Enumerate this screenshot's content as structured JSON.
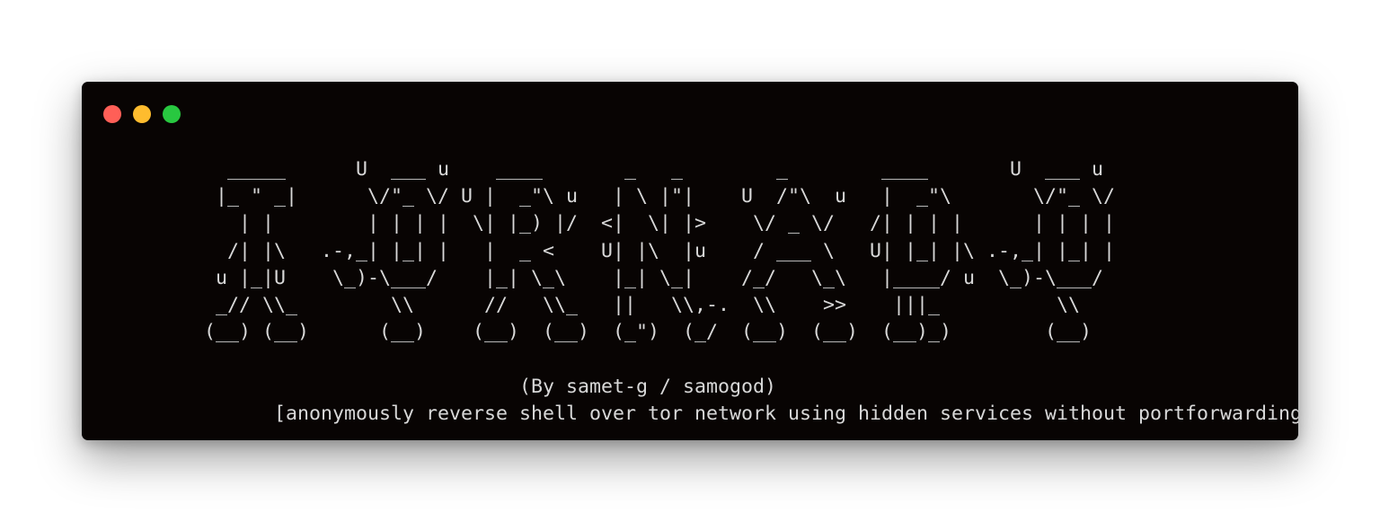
{
  "window": {
    "controls": [
      {
        "name": "close",
        "color": "#ff5f57"
      },
      {
        "name": "minimize",
        "color": "#febc2e"
      },
      {
        "name": "zoom",
        "color": "#28c840"
      }
    ]
  },
  "terminal": {
    "lines": [
      "  _____      U  ___ u    ____       _   _        _        ____       U  ___ u",
      " |_ \" _|      \\/\"_ \\/ U |  _\"\\ u   | \\ |\"|    U  /\"\\  u   |  _\"\\       \\/\"_ \\/",
      "   | |        | | | |  \\| |_) |/  <|  \\| |>    \\/ _ \\/   /| | | |      | | | |",
      "  /| |\\   .-,_| |_| |   |  _ <    U| |\\  |u    / ___ \\   U| |_| |\\ .-,_| |_| |",
      " u |_|U    \\_)-\\___/    |_| \\_\\    |_| \\_|    /_/   \\_\\   |____/ u  \\_)-\\___/",
      " _// \\\\_        \\\\      //   \\\\_   ||   \\\\,-.  \\\\    >>    |||_          \\\\",
      "(__) (__)      (__)    (__)  (__)  (_\")  (_/  (__)  (__)  (__)_)        (__)",
      "",
      "                           (By samet-g / samogod)",
      "      [anonymously reverse shell over tor network using hidden services without portforwarding]"
    ]
  },
  "colors": {
    "terminal_background": "#080403",
    "text": "#d8d8d8"
  }
}
